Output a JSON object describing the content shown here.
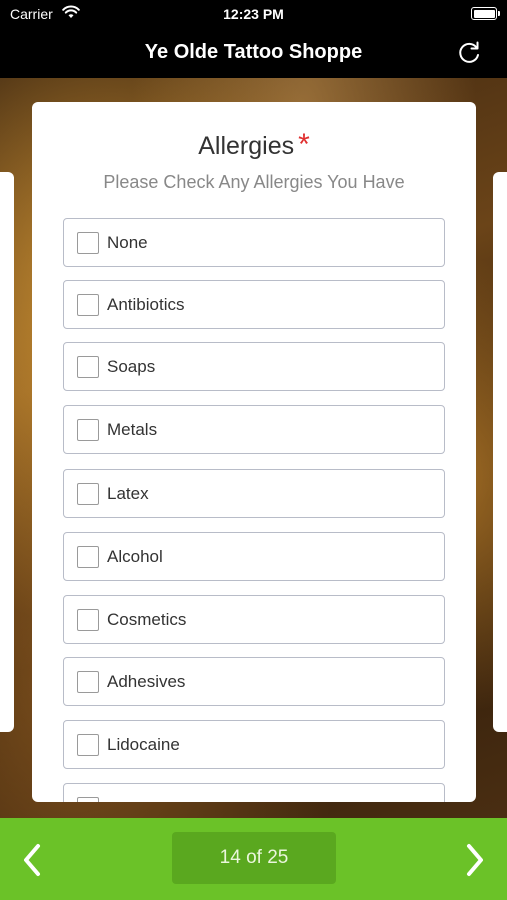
{
  "status_bar": {
    "carrier": "Carrier",
    "time": "12:23 PM"
  },
  "nav_bar": {
    "title": "Ye Olde Tattoo Shoppe",
    "refresh_icon": "refresh-icon"
  },
  "question": {
    "title": "Allergies",
    "required_marker": "*",
    "subtitle": "Please Check Any Allergies You Have",
    "options": [
      {
        "label": "None",
        "checked": false
      },
      {
        "label": "Antibiotics",
        "checked": false
      },
      {
        "label": "Soaps",
        "checked": false
      },
      {
        "label": "Metals",
        "checked": false
      },
      {
        "label": "Latex",
        "checked": false
      },
      {
        "label": "Alcohol",
        "checked": false
      },
      {
        "label": "Cosmetics",
        "checked": false
      },
      {
        "label": "Adhesives",
        "checked": false
      },
      {
        "label": "Lidocaine",
        "checked": false
      },
      {
        "label": "",
        "checked": false
      }
    ]
  },
  "pager": {
    "current": "14",
    "separator": "of",
    "total": "25"
  },
  "colors": {
    "accent_green": "#6bc228",
    "required_red": "#e03030"
  }
}
